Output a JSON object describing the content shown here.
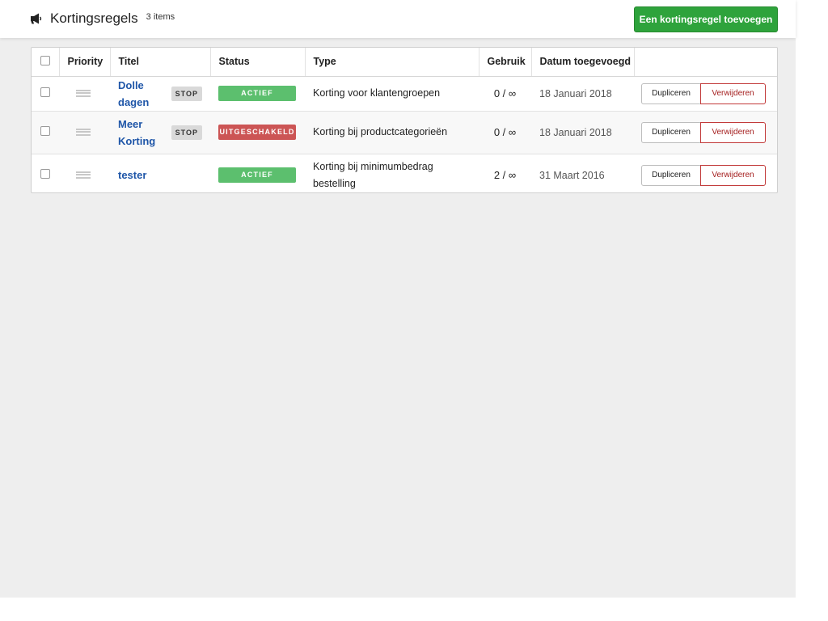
{
  "header": {
    "title": "Kortingsregels",
    "count": "3 items",
    "icon": "megaphone-icon",
    "add_button": "Een kortingsregel toevoegen"
  },
  "colors": {
    "accent_green": "#2ea33c",
    "active": "#5cbf6e",
    "disabled": "#cc5555",
    "link": "#1f56a8",
    "danger": "#c23a3a"
  },
  "table": {
    "columns": [
      "Priority",
      "Titel",
      "Status",
      "Type",
      "Gebruik",
      "Datum toegevoegd"
    ],
    "rows": [
      {
        "title": "Dolle dagen",
        "tag": "STOP",
        "status": "ACTIEF",
        "status_color": "#5cbf6e",
        "type": "Korting voor klantengroepen",
        "usage": "0 / ∞",
        "date": "18 Januari 2018",
        "duplicate": "Dupliceren",
        "delete": "Verwijderen"
      },
      {
        "title": "Meer Korting",
        "tag": "STOP",
        "status": "UITGESCHAKELD",
        "status_color": "#cc5555",
        "type": "Korting bij productcategorieën",
        "usage": "0 / ∞",
        "date": "18 Januari 2018",
        "duplicate": "Dupliceren",
        "delete": "Verwijderen"
      },
      {
        "title": "tester",
        "tag": "",
        "status": "ACTIEF",
        "status_color": "#5cbf6e",
        "type": "Korting bij minimumbedrag bestelling",
        "usage": "2 / ∞",
        "date": "31 Maart 2016",
        "duplicate": "Dupliceren",
        "delete": "Verwijderen"
      }
    ]
  }
}
